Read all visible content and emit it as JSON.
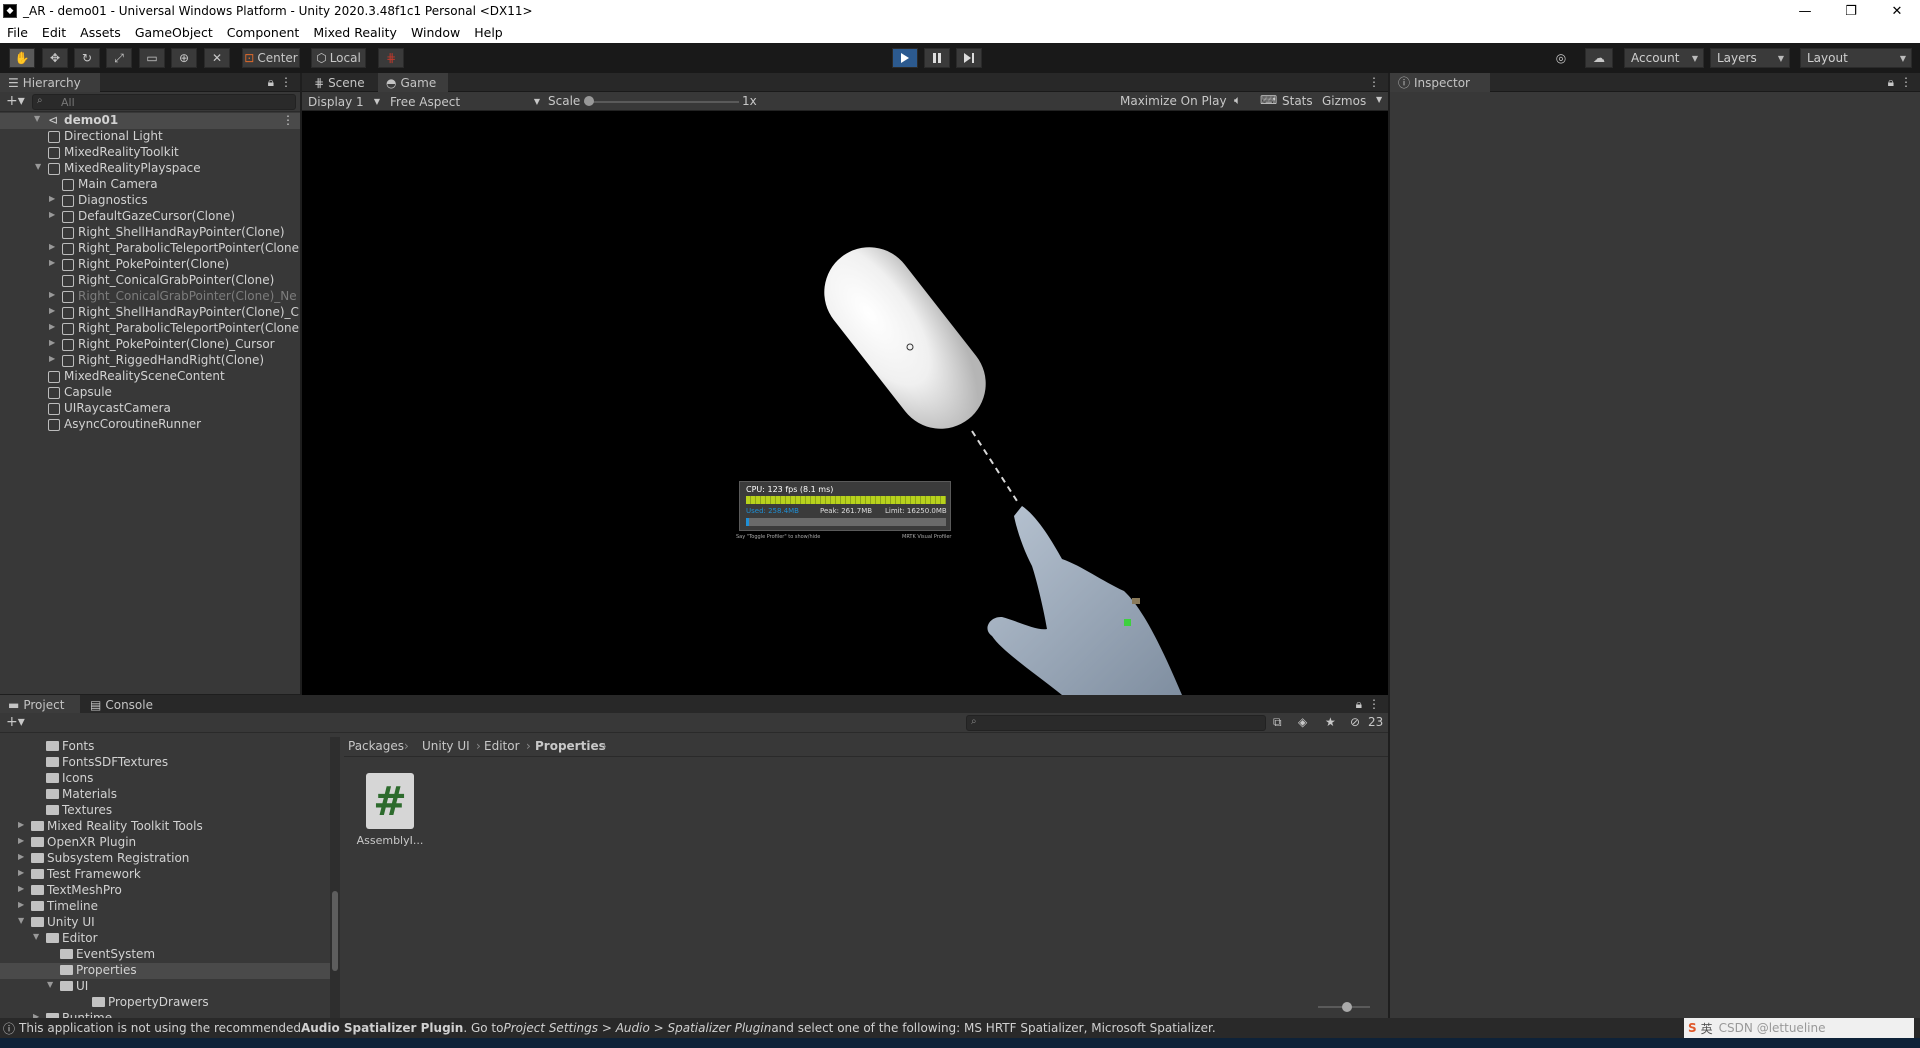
{
  "window": {
    "title": "_AR - demo01 - Universal Windows Platform - Unity 2020.3.48f1c1 Personal <DX11>",
    "minimize": "—",
    "maximize": "❐",
    "close": "✕"
  },
  "menu": [
    "File",
    "Edit",
    "Assets",
    "GameObject",
    "Component",
    "Mixed Reality",
    "Window",
    "Help"
  ],
  "toolbar": {
    "pivot": "Center",
    "space": "Local",
    "account": "Account",
    "layers": "Layers",
    "layout": "Layout"
  },
  "hierarchy": {
    "tab": "Hierarchy",
    "search_placeholder": "All",
    "scene": "demo01",
    "items": [
      {
        "label": "Directional Light"
      },
      {
        "label": "MixedRealityToolkit"
      },
      {
        "label": "MixedRealityPlayspace"
      },
      {
        "label": "Main Camera"
      },
      {
        "label": "Diagnostics"
      },
      {
        "label": "DefaultGazeCursor(Clone)"
      },
      {
        "label": "Right_ShellHandRayPointer(Clone)"
      },
      {
        "label": "Right_ParabolicTeleportPointer(Clone"
      },
      {
        "label": "Right_PokePointer(Clone)"
      },
      {
        "label": "Right_ConicalGrabPointer(Clone)"
      },
      {
        "label": "Right_ConicalGrabPointer(Clone)_Ne"
      },
      {
        "label": "Right_ShellHandRayPointer(Clone)_C"
      },
      {
        "label": "Right_ParabolicTeleportPointer(Clone"
      },
      {
        "label": "Right_PokePointer(Clone)_Cursor"
      },
      {
        "label": "Right_RiggedHandRight(Clone)"
      },
      {
        "label": "MixedRealitySceneContent"
      },
      {
        "label": "Capsule"
      },
      {
        "label": "UIRaycastCamera"
      },
      {
        "label": "AsyncCoroutineRunner"
      }
    ]
  },
  "view": {
    "scene_tab": "Scene",
    "game_tab": "Game",
    "display": "Display 1",
    "aspect": "Free Aspect",
    "scale_label": "Scale",
    "scale_value": "1x",
    "scale_level": 0,
    "maximize": "Maximize On Play",
    "stats": "Stats",
    "gizmos": "Gizmos"
  },
  "diagnostics": {
    "cpu": "CPU: 123 fps (8.1 ms)",
    "used": "Used: 258.4MB",
    "peak": "Peak: 261.7MB",
    "limit": "Limit: 16250.0MB",
    "footer_left": "Say \"Toggle Profiler\" to show/hide",
    "footer_right": "MRTK Visual Profiler"
  },
  "inspector": {
    "tab": "Inspector"
  },
  "project": {
    "project_tab": "Project",
    "console_tab": "Console",
    "count": "23",
    "breadcrumb": [
      "Packages",
      "Unity UI",
      "Editor",
      "Properties"
    ],
    "asset_label": "AssemblyI...",
    "asset_glyph": "#",
    "tree": [
      {
        "label": "Fonts"
      },
      {
        "label": "FontsSDFTextures"
      },
      {
        "label": "Icons"
      },
      {
        "label": "Materials"
      },
      {
        "label": "Textures"
      },
      {
        "label": "Mixed Reality Toolkit Tools"
      },
      {
        "label": "OpenXR Plugin"
      },
      {
        "label": "Subsystem Registration"
      },
      {
        "label": "Test Framework"
      },
      {
        "label": "TextMeshPro"
      },
      {
        "label": "Timeline"
      },
      {
        "label": "Unity UI"
      },
      {
        "label": "Editor"
      },
      {
        "label": "EventSystem"
      },
      {
        "label": "Properties"
      },
      {
        "label": "UI"
      },
      {
        "label": "PropertyDrawers"
      },
      {
        "label": "Runtime"
      }
    ]
  },
  "status": {
    "prefix": "This application is not using the recommended ",
    "plugin": "Audio Spatializer Plugin",
    "mid": ". Go to ",
    "path": "Project Settings > Audio > Spatializer Plugin",
    "suffix": " and select one of the following: MS HRTF Spatializer, Microsoft Spatializer.",
    "ime": "英",
    "watermark": "CSDN @lettueline"
  },
  "colors": {
    "accent": "#3a72b0",
    "play_active": "#4a7fc1",
    "cpu_bar": "#b8d21c",
    "mem_bar": "#1f8fd6"
  }
}
